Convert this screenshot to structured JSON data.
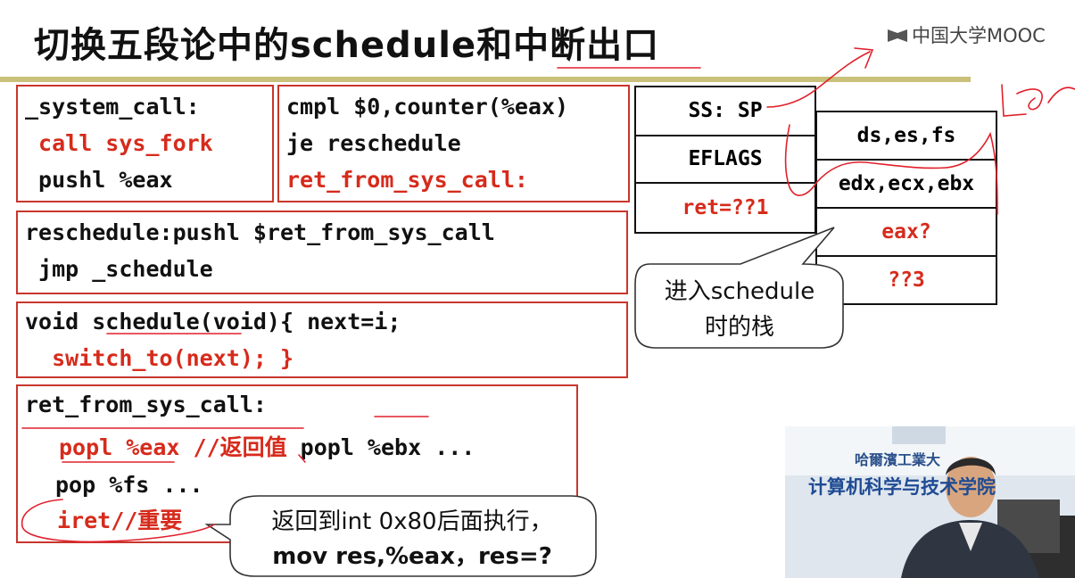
{
  "slide": {
    "title": "切换五段论中的schedule和中断出口",
    "logo": "中国大学MOOC"
  },
  "code_boxes": {
    "system_call": {
      "line1": "_system_call:",
      "line2": " call sys_fork",
      "line3": " pushl %eax"
    },
    "cmpl": {
      "line1": "cmpl $0,counter(%eax)",
      "line2": "je reschedule",
      "line3": "ret_from_sys_call:"
    },
    "reschedule": {
      "line1": "reschedule:pushl $ret_from_sys_call",
      "line2": " jmp _schedule"
    },
    "schedule": {
      "line1": "void schedule(void){ next=i;",
      "line2": "  switch_to(next); }"
    },
    "ret_from": {
      "line1": "ret_from_sys_call:",
      "line2_red": "popl %eax //返回值",
      "line2_black": " popl %ebx ...",
      "line3": "pop %fs ...",
      "line4": "iret//重要"
    }
  },
  "stack_left": [
    "SS: SP",
    "EFLAGS",
    "ret=??1"
  ],
  "stack_right": [
    "ds,es,fs",
    "edx,ecx,ebx",
    "eax?",
    "??3"
  ],
  "callout_schedule": {
    "line1": "进入schedule",
    "line2": "时的栈"
  },
  "callout_iret": {
    "line1": "返回到int 0x80后面执行，",
    "line2": "mov res,%eax，res=?"
  },
  "video": {
    "banner_top": "哈爾濱工業大",
    "banner": "计算机科学与技术学院"
  },
  "colors": {
    "accent_red": "#d62b1c",
    "rule": "#c9c07a"
  }
}
